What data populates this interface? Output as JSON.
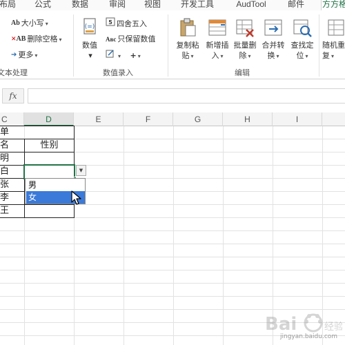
{
  "tabs": [
    "布局",
    "公式",
    "数据",
    "审阅",
    "视图",
    "开发工具",
    "AudTool",
    "邮件",
    "方方格"
  ],
  "ribbon": {
    "text_group": {
      "case_label": "大小写",
      "remove_space_label": "删除空格",
      "more_label": "更多",
      "group_label": "文本处理",
      "case_icon": "Ab",
      "remove_space_icon": "AB"
    },
    "entry_group": {
      "numeric_label": "数值",
      "round_label": "四舍五入",
      "keep_value_label": "只保留数值",
      "group_label": "数值录入",
      "keep_value_icon": "Aʙc"
    },
    "edit_group": {
      "buttons": [
        {
          "line1": "复制粘",
          "line2": "贴"
        },
        {
          "line1": "新增插",
          "line2": "入"
        },
        {
          "line1": "批量删",
          "line2": "除"
        },
        {
          "line1": "合并转",
          "line2": "换"
        },
        {
          "line1": "查找定",
          "line2": "位"
        }
      ],
      "group_label": "编辑"
    },
    "random_group": {
      "line1": "随机重",
      "line2": "复"
    }
  },
  "formula_bar": {
    "fx_label": "fx",
    "value": ""
  },
  "columns": [
    "C",
    "D",
    "E",
    "F",
    "G",
    "H",
    "I"
  ],
  "selected_column": "D",
  "cells": {
    "c1": "单",
    "c2": "名",
    "d2": "性别",
    "c3": "明",
    "c4": "白",
    "c5": "张",
    "c6": "李",
    "c7": "王"
  },
  "dropdown": {
    "options": [
      "男",
      "女"
    ],
    "highlighted": "女"
  },
  "watermark": {
    "text": "jingyan.baidu.com",
    "logo_text": "Bai"
  },
  "colors": {
    "accent": "#217346",
    "highlight": "#3b7ad9"
  }
}
